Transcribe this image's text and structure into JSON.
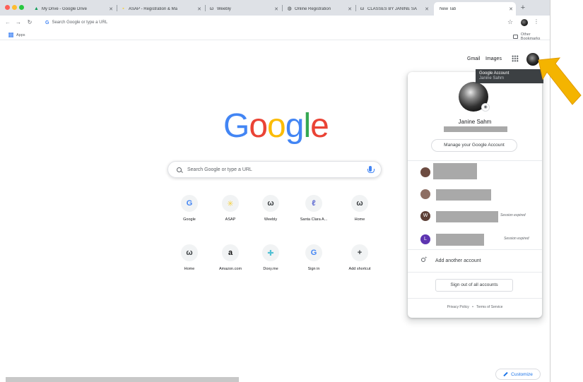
{
  "tabs": [
    {
      "label": "My Drive - Google Drive",
      "icon": "google-drive-icon",
      "active": false
    },
    {
      "label": "ASAP - Registration & Ma",
      "icon": "asap-icon",
      "active": false
    },
    {
      "label": "Weebly",
      "icon": "weebly-icon",
      "active": false
    },
    {
      "label": "Online Registration",
      "icon": "globe-icon",
      "active": false
    },
    {
      "label": "CLASSES BY JANINE SA",
      "icon": "weebly-icon",
      "active": false
    },
    {
      "label": "New Tab",
      "icon": "",
      "active": true
    }
  ],
  "toolbar": {
    "omnibox_placeholder": "Search Google or type a URL"
  },
  "bookmarks": {
    "apps_label": "Apps",
    "other_label": "Other Bookmarks"
  },
  "header": {
    "gmail_label": "Gmail",
    "images_label": "Images"
  },
  "tooltip": {
    "title": "Google Account",
    "name": "Janine Sahm"
  },
  "logo": {
    "letters": [
      "G",
      "o",
      "o",
      "g",
      "l",
      "e"
    ],
    "colors": [
      "#4285F4",
      "#EA4335",
      "#FBBC05",
      "#4285F4",
      "#34A853",
      "#EA4335"
    ]
  },
  "search": {
    "placeholder": "Search Google or type a URL"
  },
  "shortcuts": [
    {
      "label": "Google",
      "glyph": "G",
      "color": "#4285F4"
    },
    {
      "label": "ASAP",
      "glyph": "✳",
      "color": "#F4D03F"
    },
    {
      "label": "Weebly",
      "glyph": "ω",
      "color": "#3c4043"
    },
    {
      "label": "Santa Clara A...",
      "glyph": "ℓ",
      "color": "#5e6ad2"
    },
    {
      "label": "Home",
      "glyph": "ω",
      "color": "#3c4043"
    },
    {
      "label": "Home",
      "glyph": "ω",
      "color": "#3c4043"
    },
    {
      "label": "Amazon.com",
      "glyph": "a",
      "color": "#111111"
    },
    {
      "label": "Doxy.me",
      "glyph": "✚",
      "color": "#52c0d4"
    },
    {
      "label": "Sign in",
      "glyph": "G",
      "color": "#4285F4"
    },
    {
      "label": "Add shortcut",
      "glyph": "+",
      "color": "#3c4043"
    }
  ],
  "account_panel": {
    "name": "Janine Sahm",
    "manage_label": "Manage your Google Account",
    "accounts": [
      {
        "avatar_letter": "",
        "avatar_color": "#6d4c41",
        "status": ""
      },
      {
        "avatar_letter": "",
        "avatar_color": "#8d6e63",
        "status": ""
      },
      {
        "avatar_letter": "W",
        "avatar_color": "#5d4037",
        "status": "Session expired"
      },
      {
        "avatar_letter": "L",
        "avatar_color": "#5e35b1",
        "status": "Session expired"
      }
    ],
    "add_account_label": "Add another account",
    "signout_label": "Sign out of all accounts",
    "privacy_label": "Privacy Policy",
    "separator": "•",
    "terms_label": "Terms of Service"
  },
  "customize_label": "Customize",
  "colors": {
    "accent": "#1a73e8",
    "arrow": "#F4B400"
  }
}
